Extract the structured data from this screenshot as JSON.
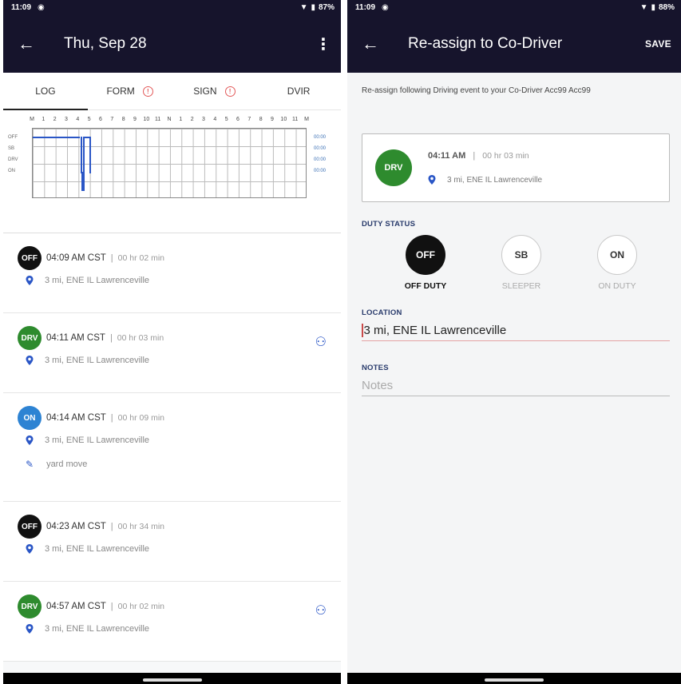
{
  "left": {
    "status": {
      "time": "11:09",
      "battery": "87%"
    },
    "appbar": {
      "back_icon": "arrow-left-icon",
      "title": "Thu, Sep 28",
      "menu_icon": "more-vert-icon"
    },
    "tabs": [
      {
        "label": "LOG",
        "active": true,
        "warning": false
      },
      {
        "label": "FORM",
        "active": false,
        "warning": true
      },
      {
        "label": "SIGN",
        "active": false,
        "warning": true
      },
      {
        "label": "DVIR",
        "active": false,
        "warning": false
      }
    ],
    "chart": {
      "hour_labels": [
        "M",
        "1",
        "2",
        "3",
        "4",
        "5",
        "6",
        "7",
        "8",
        "9",
        "10",
        "11",
        "N",
        "1",
        "2",
        "3",
        "4",
        "5",
        "6",
        "7",
        "8",
        "9",
        "10",
        "11",
        "M"
      ],
      "row_labels": [
        "OFF",
        "SB",
        "DRV",
        "ON"
      ],
      "totals": [
        "00:00",
        "00:00",
        "00:00",
        "00:00"
      ],
      "segments": [
        {
          "status": "OFF",
          "start_hr": 0,
          "end_hr": 4.15
        },
        {
          "status": "DRV",
          "start_hr": 4.18,
          "end_hr": 4.23
        },
        {
          "status": "ON",
          "start_hr": 4.23,
          "end_hr": 4.38
        },
        {
          "status": "OFF",
          "start_hr": 4.38,
          "end_hr": 4.95
        },
        {
          "status": "DRV",
          "start_hr": 4.95,
          "end_hr": 5.0
        }
      ]
    },
    "events": [
      {
        "badge": "OFF",
        "kind": "off",
        "time": "04:09 AM CST",
        "duration": "00 hr 02 min",
        "location": "3 mi, ENE IL Lawrenceville",
        "note": "",
        "reassign": false
      },
      {
        "badge": "DRV",
        "kind": "drv",
        "time": "04:11 AM CST",
        "duration": "00 hr 03 min",
        "location": "3 mi, ENE IL Lawrenceville",
        "note": "",
        "reassign": true
      },
      {
        "badge": "ON",
        "kind": "on",
        "time": "04:14 AM CST",
        "duration": "00 hr 09 min",
        "location": "3 mi, ENE IL Lawrenceville",
        "note": "yard move",
        "reassign": false
      },
      {
        "badge": "OFF",
        "kind": "off",
        "time": "04:23 AM CST",
        "duration": "00 hr 34 min",
        "location": "3 mi, ENE IL Lawrenceville",
        "note": "",
        "reassign": false
      },
      {
        "badge": "DRV",
        "kind": "drv",
        "time": "04:57 AM CST",
        "duration": "00 hr 02 min",
        "location": "3 mi, ENE IL Lawrenceville",
        "note": "",
        "reassign": true
      }
    ]
  },
  "right": {
    "status": {
      "time": "11:09",
      "battery": "88%"
    },
    "appbar": {
      "back_icon": "arrow-left-icon",
      "title": "Re-assign to Co-Driver",
      "save_label": "SAVE"
    },
    "description": "Re-assign following Driving event to your Co-Driver Acc99 Acc99",
    "event_card": {
      "badge": "DRV",
      "time": "04:11 AM",
      "duration": "00 hr 03 min",
      "location": "3 mi, ENE IL Lawrenceville"
    },
    "duty_status": {
      "label": "DUTY STATUS",
      "options": [
        {
          "code": "OFF",
          "label": "OFF DUTY",
          "selected": true
        },
        {
          "code": "SB",
          "label": "SLEEPER",
          "selected": false
        },
        {
          "code": "ON",
          "label": "ON DUTY",
          "selected": false
        }
      ]
    },
    "location": {
      "label": "LOCATION",
      "value": "3 mi, ENE IL Lawrenceville"
    },
    "notes": {
      "label": "NOTES",
      "placeholder": "Notes"
    }
  },
  "colors": {
    "appbar": "#16142c",
    "drv": "#2e8b2e",
    "on": "#2d83d3",
    "off": "#111111",
    "accent": "#2a56c6",
    "error": "#e35b5b"
  }
}
